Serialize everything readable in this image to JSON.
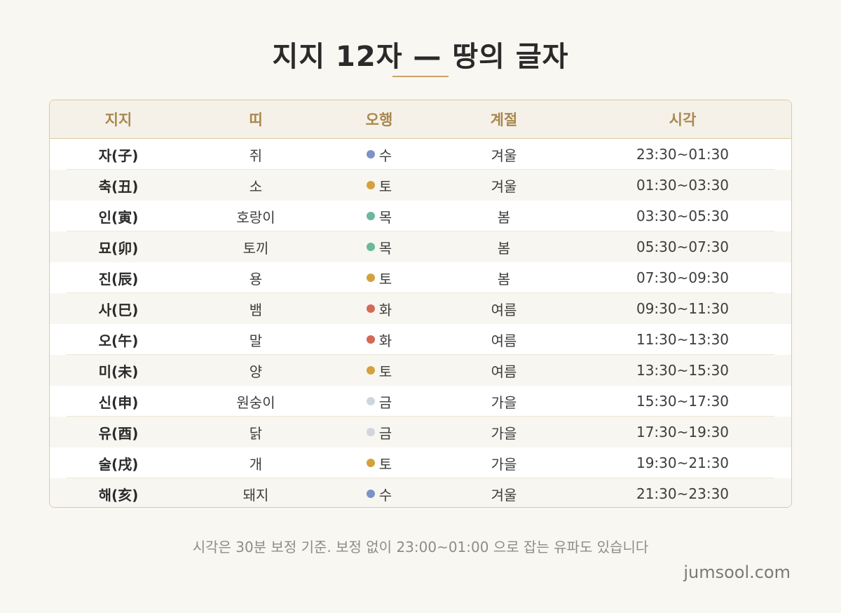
{
  "title": "지지 12자 — 땅의 글자",
  "table": {
    "headers": [
      "지지",
      "띠",
      "오행",
      "계절",
      "시각"
    ],
    "element_colors": {
      "수": "#7b93c9",
      "토": "#d4a13e",
      "목": "#6cb89a",
      "화": "#d36a55",
      "금": "#d1d6dd"
    },
    "rows": [
      {
        "branch": "자(子)",
        "animal": "쥐",
        "element": "수",
        "season": "겨울",
        "time": "23:30~01:30"
      },
      {
        "branch": "축(丑)",
        "animal": "소",
        "element": "토",
        "season": "겨울",
        "time": "01:30~03:30"
      },
      {
        "branch": "인(寅)",
        "animal": "호랑이",
        "element": "목",
        "season": "봄",
        "time": "03:30~05:30"
      },
      {
        "branch": "묘(卯)",
        "animal": "토끼",
        "element": "목",
        "season": "봄",
        "time": "05:30~07:30"
      },
      {
        "branch": "진(辰)",
        "animal": "용",
        "element": "토",
        "season": "봄",
        "time": "07:30~09:30"
      },
      {
        "branch": "사(巳)",
        "animal": "뱀",
        "element": "화",
        "season": "여름",
        "time": "09:30~11:30"
      },
      {
        "branch": "오(午)",
        "animal": "말",
        "element": "화",
        "season": "여름",
        "time": "11:30~13:30"
      },
      {
        "branch": "미(未)",
        "animal": "양",
        "element": "토",
        "season": "여름",
        "time": "13:30~15:30"
      },
      {
        "branch": "신(申)",
        "animal": "원숭이",
        "element": "금",
        "season": "가을",
        "time": "15:30~17:30"
      },
      {
        "branch": "유(酉)",
        "animal": "닭",
        "element": "금",
        "season": "가을",
        "time": "17:30~19:30"
      },
      {
        "branch": "술(戌)",
        "animal": "개",
        "element": "토",
        "season": "가을",
        "time": "19:30~21:30"
      },
      {
        "branch": "해(亥)",
        "animal": "돼지",
        "element": "수",
        "season": "겨울",
        "time": "21:30~23:30"
      }
    ]
  },
  "footnote": "시각은 30분 보정 기준. 보정 없이 23:00~01:00 으로 잡는 유파도 있습니다",
  "brand": "jumsool.com"
}
